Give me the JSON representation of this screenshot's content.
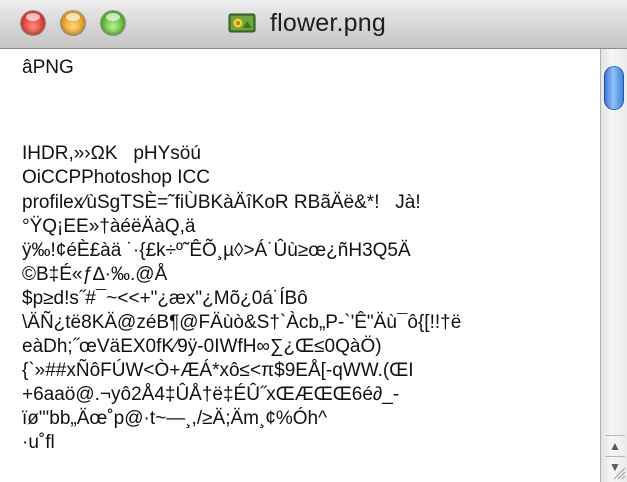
{
  "window": {
    "title": "flower.png",
    "controls": {
      "close": "close",
      "minimize": "minimize",
      "zoom": "zoom"
    },
    "file_icon": "image-file-icon"
  },
  "content": {
    "lines": [
      "âPNG",
      "",
      "",
      "IHDR,»›ΩK   pHYsöú",
      "OiCCPPhotoshop ICC",
      "profilex⁄ùSgTSÈ=˜fiÙBKàÄîKoR RBãÄë&*!   Jà!",
      "°ŸQ¡EE»†àéëÄàQ,ä",
      "ÿ‰!¢éÈ£àä ˙·{£k÷º˜ÊÕ¸µ◊>Á˙Ûù≥œ¿ñH3Q5Ä",
      "©B‡É«ƒ∆·‰.@Å",
      "$p≥d!s˝#¯~<<+\"¿æx\"¿Mõ¿0á˙ÍBô",
      "\\ÄÑ¿të8KÄ@zéB¶@FÄùò&S†`Àcb„P-`'Ê\"Äù¯ô{[!!†ë",
      "eàDh;˝œVäEX0fK⁄9ÿ-0IWfH∞∑¿Œ≤0QàÖ)",
      "{`»##xÑôFÚW<Ò+ÆÁ*xô≤<π$9EÅ[-qWW.(ŒI",
      "+6aaö@.¬yô2Å4‡ÛÅ†ë‡ÉÛ˝xŒÆŒŒ6é∂_-",
      "ïø\"'bb„Äœ˚p@·t~—¸,/≥Ä;Äm¸¢%Óh^",
      "·u˚fl"
    ]
  },
  "scrollbar": {
    "up_arrow": "▲",
    "down_arrow": "▼"
  },
  "colors": {
    "close": "#d9322a",
    "minimize": "#e19a1b",
    "zoom": "#4fae28",
    "scroll_thumb": "#3c7fdc"
  }
}
